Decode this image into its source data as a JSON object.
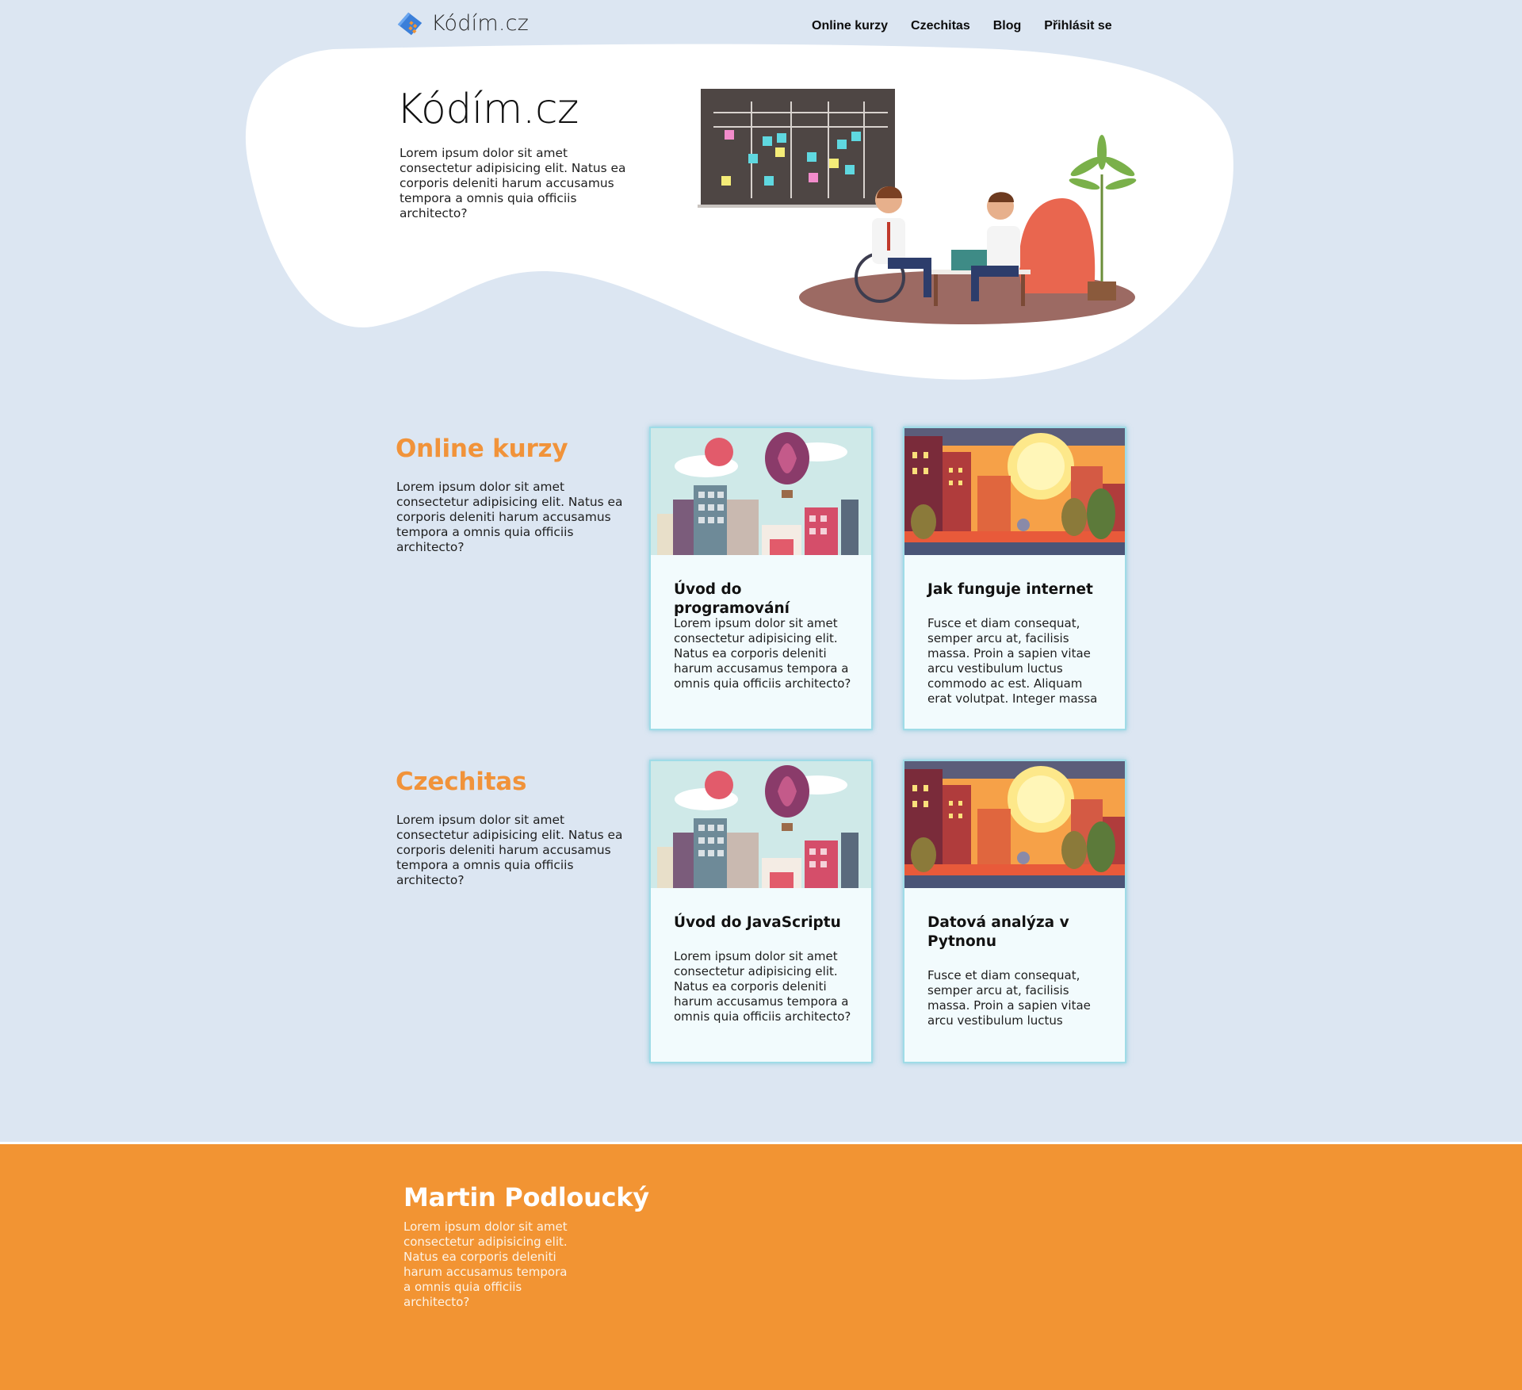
{
  "nav": {
    "brand": "Kódím.cz",
    "links": [
      "Online kurzy",
      "Czechitas",
      "Blog",
      "Přihlásit se"
    ]
  },
  "hero": {
    "title": "Kódím.cz",
    "text": "Lorem ipsum dolor sit amet consectetur adipisicing elit. Natus ea corporis deleniti harum accusamus tempora a omnis quia officiis architecto?"
  },
  "sections": [
    {
      "title": "Online kurzy",
      "text": "Lorem ipsum dolor sit amet consectetur adipisicing elit. Natus ea corporis deleniti harum accusamus tempora a omnis quia officiis architecto?",
      "cards": [
        {
          "title": "Úvod do programování",
          "text": "Lorem ipsum dolor sit amet consectetur adipisicing elit. Natus ea corporis deleniti harum accusamus tempora a omnis quia officiis architecto?",
          "image": "city-balloon-illustration"
        },
        {
          "title": "Jak funguje internet",
          "text": "Fusce et diam consequat, semper arcu at, facilisis massa. Proin a sapien vitae arcu vestibulum luctus commodo ac est. Aliquam erat volutpat. Integer massa",
          "image": "city-sunset-illustration"
        }
      ]
    },
    {
      "title": "Czechitas",
      "text": "Lorem ipsum dolor sit amet consectetur adipisicing elit. Natus ea corporis deleniti harum accusamus tempora a omnis quia officiis architecto?",
      "cards": [
        {
          "title": "Úvod do JavaScriptu",
          "text": "Lorem ipsum dolor sit amet consectetur adipisicing elit. Natus ea corporis deleniti harum accusamus tempora a omnis quia officiis architecto?",
          "image": "city-balloon-illustration"
        },
        {
          "title": "Datová analýza v Pytnonu",
          "text": "Fusce et diam consequat, semper arcu at, facilisis massa. Proin a sapien vitae arcu vestibulum luctus",
          "image": "city-sunset-illustration"
        }
      ]
    }
  ],
  "footer": {
    "name": "Martin Podloucký",
    "text": "Lorem ipsum dolor sit amet consectetur adipisicing elit. Natus ea corporis deleniti harum accusamus tempora a omnis quia officiis architecto?"
  },
  "colors": {
    "page_background": "#dce6f2",
    "accent_orange": "#f1933a",
    "footer_background": "#f29433",
    "card_border": "#9fdce7"
  }
}
